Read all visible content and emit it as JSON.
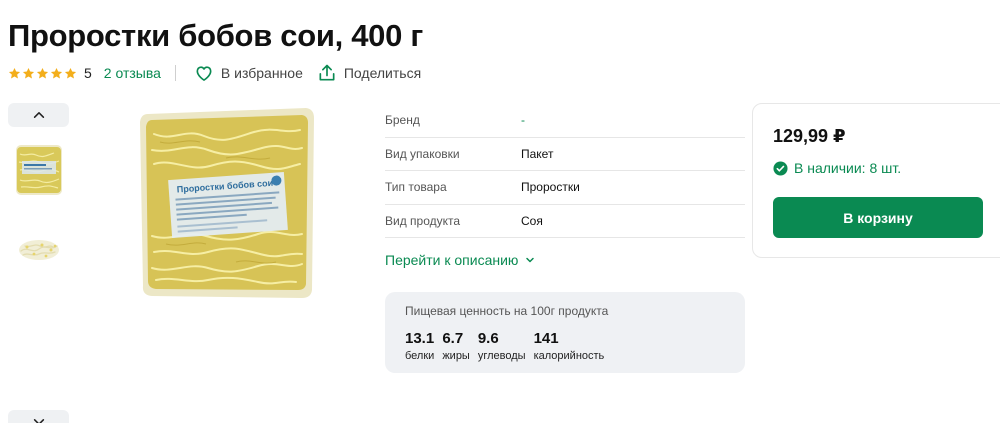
{
  "product": {
    "title": "Проростки бобов сои, 400 г",
    "rating": "5",
    "reviews_label": "2 отзыва",
    "favorite_label": "В избранное",
    "share_label": "Поделиться",
    "rating_stars": 5
  },
  "gallery": {
    "up_icon": "chevron-up-icon",
    "down_icon": "chevron-down-icon",
    "package_label": "Проростки бобов сои"
  },
  "specs": [
    {
      "label": "Бренд",
      "value": "-"
    },
    {
      "label": "Вид упаковки",
      "value": "Пакет"
    },
    {
      "label": "Тип товара",
      "value": "Проростки"
    },
    {
      "label": "Вид продукта",
      "value": "Соя"
    }
  ],
  "description_link": "Перейти к описанию",
  "nutrition": {
    "title": "Пищевая ценность на 100г продукта",
    "items": [
      {
        "value": "13.1",
        "label": "белки"
      },
      {
        "value": "6.7",
        "label": "жиры"
      },
      {
        "value": "9.6",
        "label": "углеводы"
      },
      {
        "value": "141",
        "label": "калорийность"
      }
    ]
  },
  "buy": {
    "price": "129,99 ₽",
    "stock": "В наличии: 8 шт.",
    "cart_button": "В корзину"
  },
  "colors": {
    "accent": "#0a8a52",
    "star": "#f3ae1b",
    "panel": "#eff1f4"
  }
}
